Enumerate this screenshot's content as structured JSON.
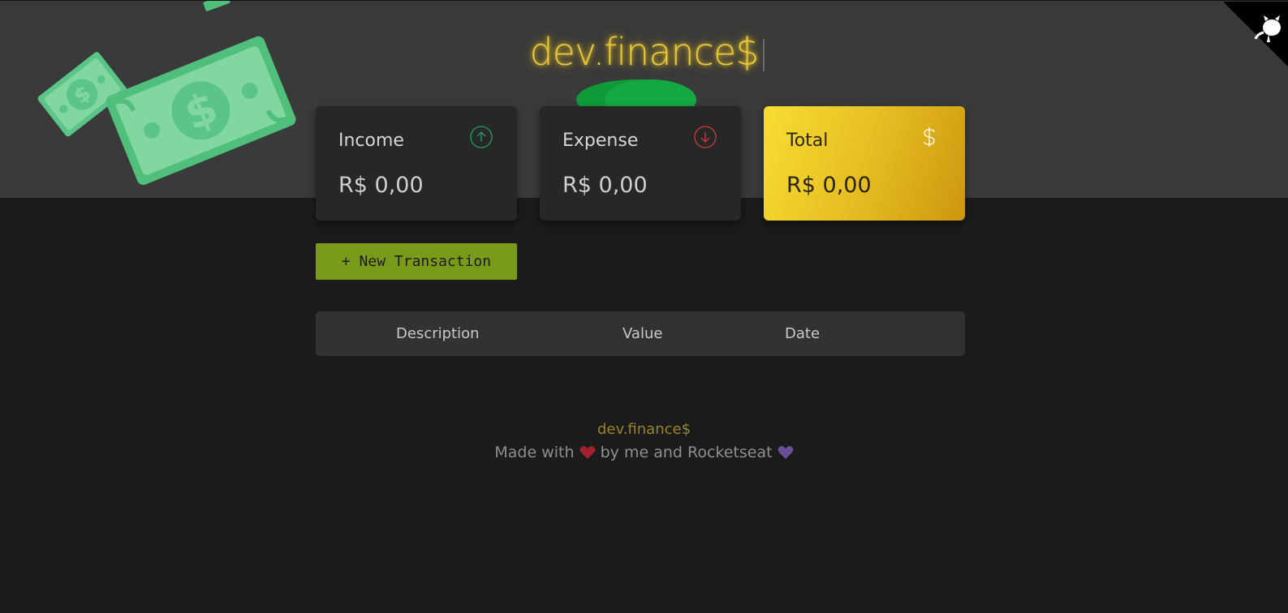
{
  "header": {
    "logo": "dev.finance$",
    "money_illustration": "flying-money-bills",
    "github_corner_icon": "github-octocat-icon"
  },
  "cards": {
    "income": {
      "title": "Income",
      "value": "R$ 0,00",
      "icon": "arrow-up-circle-icon",
      "icon_color": "#1fa35a"
    },
    "expense": {
      "title": "Expense",
      "value": "R$ 0,00",
      "icon": "arrow-down-circle-icon",
      "icon_color": "#d23a3a"
    },
    "total": {
      "title": "Total",
      "value": "R$ 0,00",
      "icon": "dollar-sign-icon",
      "accent": "#f3d22e"
    }
  },
  "actions": {
    "new_transaction": "+ New Transaction"
  },
  "table": {
    "columns": [
      "Description",
      "Value",
      "Date"
    ],
    "rows": []
  },
  "footer": {
    "brand": "dev.finance$",
    "made_prefix": "Made with",
    "made_middle": "by me and Rocketseat",
    "heart_red": "#c0283a",
    "heart_purple": "#7a5aa8"
  },
  "colors": {
    "header_bg": "#3a3a3a",
    "page_bg": "#1b1b1b",
    "button_bg": "#7a9a1a",
    "logo_glow": "#e8c93a"
  }
}
